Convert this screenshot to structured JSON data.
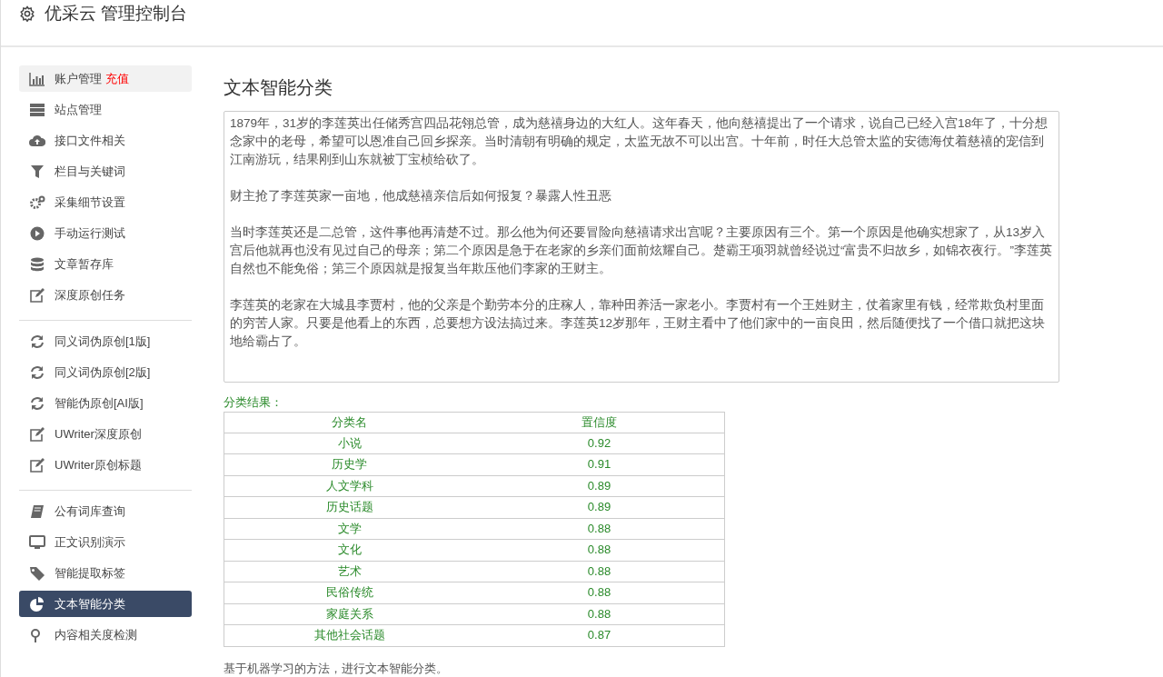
{
  "header": {
    "title": "优采云 管理控制台"
  },
  "sidebar": {
    "groups": [
      {
        "items": [
          {
            "label": "账户管理",
            "badge": "充值",
            "selected": false,
            "hovered": true
          },
          {
            "label": "站点管理",
            "selected": false,
            "hovered": false
          },
          {
            "label": "接口文件相关",
            "selected": false,
            "hovered": false
          },
          {
            "label": "栏目与关键词",
            "selected": false,
            "hovered": false
          },
          {
            "label": "采集细节设置",
            "selected": false,
            "hovered": false
          },
          {
            "label": "手动运行测试",
            "selected": false,
            "hovered": false
          },
          {
            "label": "文章暂存库",
            "selected": false,
            "hovered": false
          },
          {
            "label": "深度原创任务",
            "selected": false,
            "hovered": false
          }
        ]
      },
      {
        "items": [
          {
            "label": "同义词伪原创[1版]",
            "selected": false,
            "hovered": false
          },
          {
            "label": "同义词伪原创[2版]",
            "selected": false,
            "hovered": false
          },
          {
            "label": "智能伪原创[AI版]",
            "selected": false,
            "hovered": false
          },
          {
            "label": "UWriter深度原创",
            "selected": false,
            "hovered": false
          },
          {
            "label": "UWriter原创标题",
            "selected": false,
            "hovered": false
          }
        ]
      },
      {
        "items": [
          {
            "label": "公有词库查询",
            "selected": false,
            "hovered": false
          },
          {
            "label": "正文识别演示",
            "selected": false,
            "hovered": false
          },
          {
            "label": "智能提取标签",
            "selected": false,
            "hovered": false
          },
          {
            "label": "文本智能分类",
            "selected": true,
            "hovered": false
          },
          {
            "label": "内容相关度检测",
            "selected": false,
            "hovered": false
          }
        ]
      }
    ]
  },
  "main": {
    "title": "文本智能分类",
    "text_input": {
      "paragraphs": [
        "1879年，31岁的李莲英出任储秀宫四品花翎总管，成为慈禧身边的大红人。这年春天，他向慈禧提出了一个请求，说自己已经入宫18年了，十分想念家中的老母，希望可以恩准自己回乡探亲。当时清朝有明确的规定，太监无故不可以出宫。十年前，时任大总管太监的安德海仗着慈禧的宠信到江南游玩，结果刚到山东就被丁宝桢给砍了。",
        "财主抢了李莲英家一亩地，他成慈禧亲信后如何报复？暴露人性丑恶",
        "当时李莲英还是二总管，这件事他再清楚不过。那么他为何还要冒险向慈禧请求出宫呢？主要原因有三个。第一个原因是他确实想家了，从13岁入宫后他就再也没有见过自己的母亲；第二个原因是急于在老家的乡亲们面前炫耀自己。楚霸王项羽就曾经说过“富贵不归故乡，如锦衣夜行。”李莲英自然也不能免俗；第三个原因就是报复当年欺压他们李家的王财主。",
        "李莲英的老家在大城县李贾村，他的父亲是个勤劳本分的庄稼人，靠种田养活一家老小。李贾村有一个王姓财主，仗着家里有钱，经常欺负村里面的穷苦人家。只要是他看上的东西，总要想方设法搞过来。李莲英12岁那年，王财主看中了他们家中的一亩良田，然后随便找了一个借口就把这块地给霸占了。"
      ]
    },
    "results_label": "分类结果：",
    "table": {
      "columns": [
        "分类名",
        "置信度"
      ],
      "rows": [
        [
          "小说",
          "0.92"
        ],
        [
          "历史学",
          "0.91"
        ],
        [
          "人文学科",
          "0.89"
        ],
        [
          "历史话题",
          "0.89"
        ],
        [
          "文学",
          "0.88"
        ],
        [
          "文化",
          "0.88"
        ],
        [
          "艺术",
          "0.88"
        ],
        [
          "民俗传统",
          "0.88"
        ],
        [
          "家庭关系",
          "0.88"
        ],
        [
          "其他社会话题",
          "0.87"
        ]
      ]
    },
    "footnote": "基于机器学习的方法，进行文本智能分类。"
  }
}
